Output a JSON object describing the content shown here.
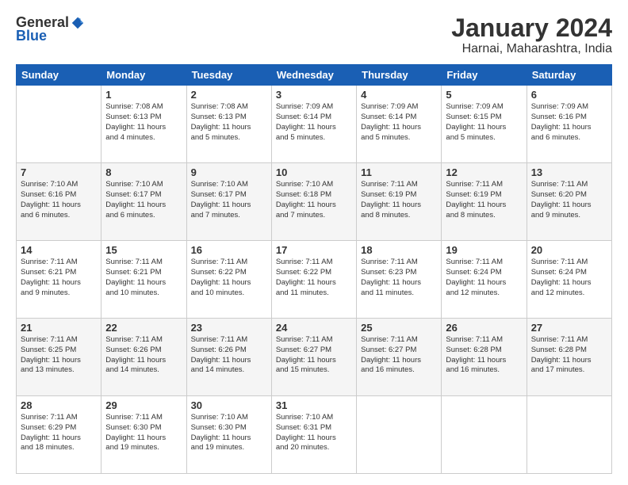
{
  "logo": {
    "general": "General",
    "blue": "Blue"
  },
  "title": "January 2024",
  "subtitle": "Harnai, Maharashtra, India",
  "days_of_week": [
    "Sunday",
    "Monday",
    "Tuesday",
    "Wednesday",
    "Thursday",
    "Friday",
    "Saturday"
  ],
  "weeks": [
    [
      {
        "day": "",
        "info": ""
      },
      {
        "day": "1",
        "info": "Sunrise: 7:08 AM\nSunset: 6:13 PM\nDaylight: 11 hours\nand 4 minutes."
      },
      {
        "day": "2",
        "info": "Sunrise: 7:08 AM\nSunset: 6:13 PM\nDaylight: 11 hours\nand 5 minutes."
      },
      {
        "day": "3",
        "info": "Sunrise: 7:09 AM\nSunset: 6:14 PM\nDaylight: 11 hours\nand 5 minutes."
      },
      {
        "day": "4",
        "info": "Sunrise: 7:09 AM\nSunset: 6:14 PM\nDaylight: 11 hours\nand 5 minutes."
      },
      {
        "day": "5",
        "info": "Sunrise: 7:09 AM\nSunset: 6:15 PM\nDaylight: 11 hours\nand 5 minutes."
      },
      {
        "day": "6",
        "info": "Sunrise: 7:09 AM\nSunset: 6:16 PM\nDaylight: 11 hours\nand 6 minutes."
      }
    ],
    [
      {
        "day": "7",
        "info": "Sunrise: 7:10 AM\nSunset: 6:16 PM\nDaylight: 11 hours\nand 6 minutes."
      },
      {
        "day": "8",
        "info": "Sunrise: 7:10 AM\nSunset: 6:17 PM\nDaylight: 11 hours\nand 6 minutes."
      },
      {
        "day": "9",
        "info": "Sunrise: 7:10 AM\nSunset: 6:17 PM\nDaylight: 11 hours\nand 7 minutes."
      },
      {
        "day": "10",
        "info": "Sunrise: 7:10 AM\nSunset: 6:18 PM\nDaylight: 11 hours\nand 7 minutes."
      },
      {
        "day": "11",
        "info": "Sunrise: 7:11 AM\nSunset: 6:19 PM\nDaylight: 11 hours\nand 8 minutes."
      },
      {
        "day": "12",
        "info": "Sunrise: 7:11 AM\nSunset: 6:19 PM\nDaylight: 11 hours\nand 8 minutes."
      },
      {
        "day": "13",
        "info": "Sunrise: 7:11 AM\nSunset: 6:20 PM\nDaylight: 11 hours\nand 9 minutes."
      }
    ],
    [
      {
        "day": "14",
        "info": "Sunrise: 7:11 AM\nSunset: 6:21 PM\nDaylight: 11 hours\nand 9 minutes."
      },
      {
        "day": "15",
        "info": "Sunrise: 7:11 AM\nSunset: 6:21 PM\nDaylight: 11 hours\nand 10 minutes."
      },
      {
        "day": "16",
        "info": "Sunrise: 7:11 AM\nSunset: 6:22 PM\nDaylight: 11 hours\nand 10 minutes."
      },
      {
        "day": "17",
        "info": "Sunrise: 7:11 AM\nSunset: 6:22 PM\nDaylight: 11 hours\nand 11 minutes."
      },
      {
        "day": "18",
        "info": "Sunrise: 7:11 AM\nSunset: 6:23 PM\nDaylight: 11 hours\nand 11 minutes."
      },
      {
        "day": "19",
        "info": "Sunrise: 7:11 AM\nSunset: 6:24 PM\nDaylight: 11 hours\nand 12 minutes."
      },
      {
        "day": "20",
        "info": "Sunrise: 7:11 AM\nSunset: 6:24 PM\nDaylight: 11 hours\nand 12 minutes."
      }
    ],
    [
      {
        "day": "21",
        "info": "Sunrise: 7:11 AM\nSunset: 6:25 PM\nDaylight: 11 hours\nand 13 minutes."
      },
      {
        "day": "22",
        "info": "Sunrise: 7:11 AM\nSunset: 6:26 PM\nDaylight: 11 hours\nand 14 minutes."
      },
      {
        "day": "23",
        "info": "Sunrise: 7:11 AM\nSunset: 6:26 PM\nDaylight: 11 hours\nand 14 minutes."
      },
      {
        "day": "24",
        "info": "Sunrise: 7:11 AM\nSunset: 6:27 PM\nDaylight: 11 hours\nand 15 minutes."
      },
      {
        "day": "25",
        "info": "Sunrise: 7:11 AM\nSunset: 6:27 PM\nDaylight: 11 hours\nand 16 minutes."
      },
      {
        "day": "26",
        "info": "Sunrise: 7:11 AM\nSunset: 6:28 PM\nDaylight: 11 hours\nand 16 minutes."
      },
      {
        "day": "27",
        "info": "Sunrise: 7:11 AM\nSunset: 6:28 PM\nDaylight: 11 hours\nand 17 minutes."
      }
    ],
    [
      {
        "day": "28",
        "info": "Sunrise: 7:11 AM\nSunset: 6:29 PM\nDaylight: 11 hours\nand 18 minutes."
      },
      {
        "day": "29",
        "info": "Sunrise: 7:11 AM\nSunset: 6:30 PM\nDaylight: 11 hours\nand 19 minutes."
      },
      {
        "day": "30",
        "info": "Sunrise: 7:10 AM\nSunset: 6:30 PM\nDaylight: 11 hours\nand 19 minutes."
      },
      {
        "day": "31",
        "info": "Sunrise: 7:10 AM\nSunset: 6:31 PM\nDaylight: 11 hours\nand 20 minutes."
      },
      {
        "day": "",
        "info": ""
      },
      {
        "day": "",
        "info": ""
      },
      {
        "day": "",
        "info": ""
      }
    ]
  ]
}
